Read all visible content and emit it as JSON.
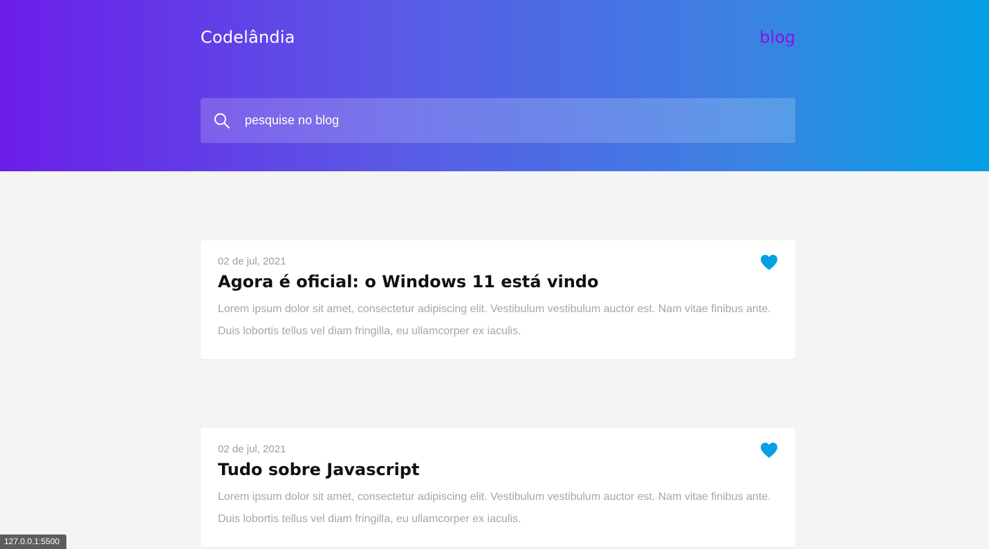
{
  "header": {
    "brand": "Codelândia",
    "nav_link": "blog"
  },
  "search": {
    "placeholder": "pesquise no blog",
    "icon": "search-icon"
  },
  "posts": [
    {
      "date": "02 de jul, 2021",
      "title": "Agora é oficial: o Windows 11 está vindo",
      "excerpt": "Lorem ipsum dolor sit amet, consectetur adipiscing elit. Vestibulum vestibulum auctor est. Nam vitae finibus ante. Duis lobortis tellus vel diam fringilla, eu ullamcorper ex iaculis.",
      "icon": "heart-icon"
    },
    {
      "date": "02 de jul, 2021",
      "title": "Tudo sobre Javascript",
      "excerpt": "Lorem ipsum dolor sit amet, consectetur adipiscing elit. Vestibulum vestibulum auctor est. Nam vitae finibus ante. Duis lobortis tellus vel diam fringilla, eu ullamcorper ex iaculis.",
      "icon": "heart-icon"
    }
  ],
  "status_bar": {
    "url": "127.0.0.1:5500"
  },
  "colors": {
    "gradient_start": "#6b1ee8",
    "gradient_end": "#03a0e3",
    "nav_link": "#8a12e0",
    "heart": "#03a0e3",
    "background": "#f3f4f6"
  }
}
